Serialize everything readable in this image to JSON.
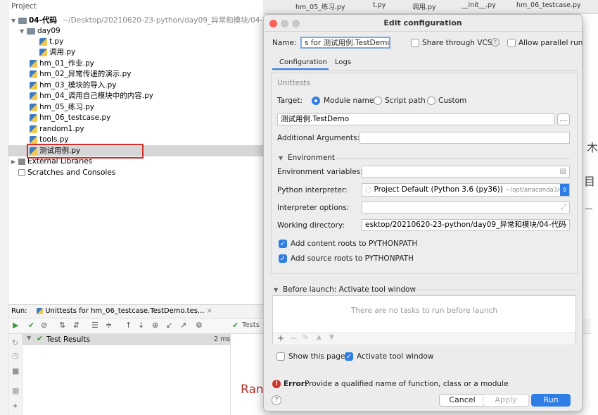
{
  "tree": {
    "header": "Project",
    "root": {
      "name": "04-代码",
      "path": "~/Desktop/20210620-23-python/day09_异常和模块/04-代码"
    },
    "folder": "day09",
    "folder_files": [
      "t.py",
      "调用.py"
    ],
    "files": [
      "hm_01_作业.py",
      "hm_02_异常传递的演示.py",
      "hm_03_模块的导入.py",
      "hm_04_调用自己模块中的内容.py",
      "hm_05_练习.py",
      "hm_06_testcase.py",
      "random1.py",
      "tools.py",
      "测试用例.py"
    ],
    "external": "External Libraries",
    "scratches": "Scratches and Consoles"
  },
  "tabs": [
    "hm_05_练习.py",
    "t.py",
    "调用.py",
    "__init__.py",
    "hm_06_testcase.py"
  ],
  "run": {
    "label": "Run:",
    "config_tab": "Unittests for hm_06_testcase.TestDemo.tes...",
    "tests_label": "Tests",
    "result_label": "Test Results",
    "duration": "2 ms",
    "editor_fragment": "Ran"
  },
  "dialog": {
    "title": "Edit configuration",
    "name_label": "Name:",
    "name_value": "s for 测试用例.TestDemo",
    "share_vcs": "Share through VCS",
    "allow_parallel": "Allow parallel run",
    "tabs": [
      "Configuration",
      "Logs"
    ],
    "section_unittests": "Unittests",
    "target_label": "Target:",
    "target_options": [
      "Module name",
      "Script path",
      "Custom"
    ],
    "target_value": "测试用例.TestDemo",
    "additional_args_label": "Additional Arguments:",
    "environment_label": "Environment",
    "env_vars_label": "Environment variables:",
    "interpreter_label": "Python interpreter:",
    "interpreter_value": "Project Default (Python 3.6 (py36))",
    "interpreter_path": "~/opt/anaconda3/envs/",
    "interp_options_label": "Interpreter options:",
    "working_dir_label": "Working directory:",
    "working_dir_value": "esktop/20210620-23-python/day09_异常和模块/04-代码",
    "add_content_roots": "Add content roots to PYTHONPATH",
    "add_source_roots": "Add source roots to PYTHONPATH",
    "before_launch": "Before launch: Activate tool window",
    "no_tasks": "There are no tasks to run before launch",
    "show_page": "Show this page",
    "activate_tool": "Activate tool window",
    "error_label": "Error:",
    "error_text": "Provide a qualified name of function, class or a module",
    "buttons": {
      "cancel": "Cancel",
      "apply": "Apply",
      "run": "Run"
    }
  },
  "colors": {
    "accent": "#2f7ee6",
    "highlight": "#d0302b",
    "error": "#d0302b",
    "pass": "#3a9b3a"
  }
}
